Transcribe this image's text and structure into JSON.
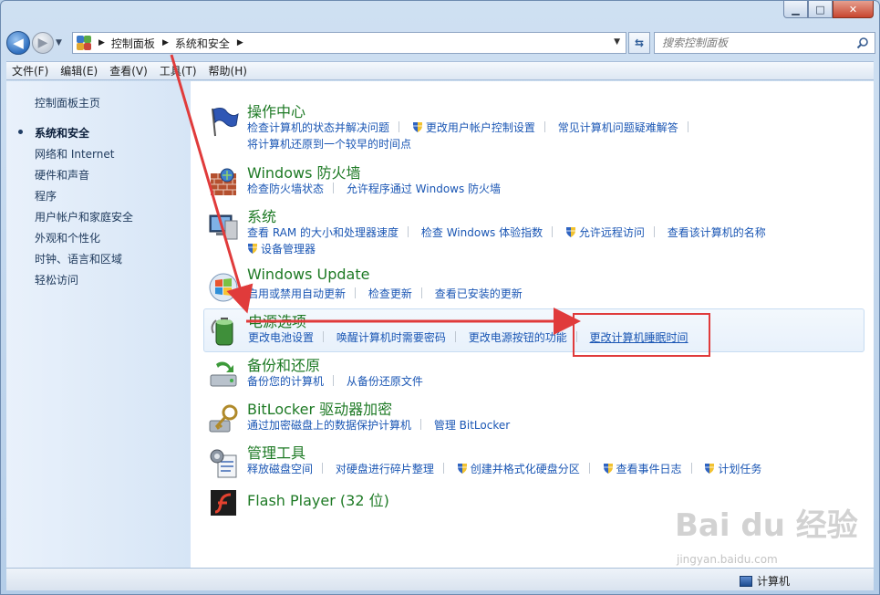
{
  "window": {
    "caption_min": "▁",
    "caption_max": "□",
    "caption_close": "✕"
  },
  "navigation": {
    "back_glyph": "◀",
    "forward_glyph": "▶",
    "breadcrumbs": [
      "控制面板",
      "系统和安全"
    ],
    "search_placeholder": "搜索控制面板"
  },
  "menubar": {
    "items": [
      "文件(F)",
      "编辑(E)",
      "查看(V)",
      "工具(T)",
      "帮助(H)"
    ]
  },
  "sidebar": {
    "home": "控制面板主页",
    "items": [
      "系统和安全",
      "网络和 Internet",
      "硬件和声音",
      "程序",
      "用户帐户和家庭安全",
      "外观和个性化",
      "时钟、语言和区域",
      "轻松访问"
    ],
    "active_index": 0
  },
  "categories": [
    {
      "title": "操作中心",
      "icon": "flag-icon",
      "rows": [
        [
          {
            "text": "检查计算机的状态并解决问题"
          },
          {
            "text": "更改用户帐户控制设置",
            "shield": true
          },
          {
            "text": "常见计算机问题疑难解答"
          }
        ],
        [
          {
            "text": "将计算机还原到一个较早的时间点"
          }
        ]
      ]
    },
    {
      "title": "Windows 防火墙",
      "icon": "firewall-icon",
      "rows": [
        [
          {
            "text": "检查防火墙状态"
          },
          {
            "text": "允许程序通过 Windows 防火墙"
          }
        ]
      ]
    },
    {
      "title": "系统",
      "icon": "system-icon",
      "rows": [
        [
          {
            "text": "查看 RAM 的大小和处理器速度"
          },
          {
            "text": "检查 Windows 体验指数"
          },
          {
            "text": "允许远程访问",
            "shield": true
          },
          {
            "text": "查看该计算机的名称"
          }
        ],
        [
          {
            "text": "设备管理器",
            "shield": true
          }
        ]
      ]
    },
    {
      "title": "Windows Update",
      "icon": "windows-update-icon",
      "rows": [
        [
          {
            "text": "启用或禁用自动更新"
          },
          {
            "text": "检查更新"
          },
          {
            "text": "查看已安装的更新"
          }
        ]
      ]
    },
    {
      "title": "电源选项",
      "icon": "battery-icon",
      "rows": [
        [
          {
            "text": "更改电池设置"
          },
          {
            "text": "唤醒计算机时需要密码"
          },
          {
            "text": "更改电源按钮的功能"
          },
          {
            "text": "更改计算机睡眠时间",
            "underline": true
          }
        ]
      ]
    },
    {
      "title": "备份和还原",
      "icon": "backup-icon",
      "rows": [
        [
          {
            "text": "备份您的计算机"
          },
          {
            "text": "从备份还原文件"
          }
        ]
      ]
    },
    {
      "title": "BitLocker 驱动器加密",
      "icon": "bitlocker-key-icon",
      "rows": [
        [
          {
            "text": "通过加密磁盘上的数据保护计算机"
          },
          {
            "text": "管理 BitLocker"
          }
        ]
      ]
    },
    {
      "title": "管理工具",
      "icon": "admin-tools-icon",
      "rows": [
        [
          {
            "text": "释放磁盘空间"
          },
          {
            "text": "对硬盘进行碎片整理"
          },
          {
            "text": "创建并格式化硬盘分区",
            "shield": true
          },
          {
            "text": "查看事件日志",
            "shield": true
          },
          {
            "text": "计划任务",
            "shield": true
          }
        ]
      ]
    },
    {
      "title": "Flash Player (32 位)",
      "icon": "flash-icon",
      "rows": []
    }
  ],
  "statusbar": {
    "computer_label": "计算机"
  },
  "watermark": {
    "brand": "Bai du 经验",
    "url": "jingyan.baidu.com"
  },
  "colors": {
    "category_title": "#1e7a25",
    "link": "#1a56b4",
    "annotation": "#e03b3b"
  }
}
